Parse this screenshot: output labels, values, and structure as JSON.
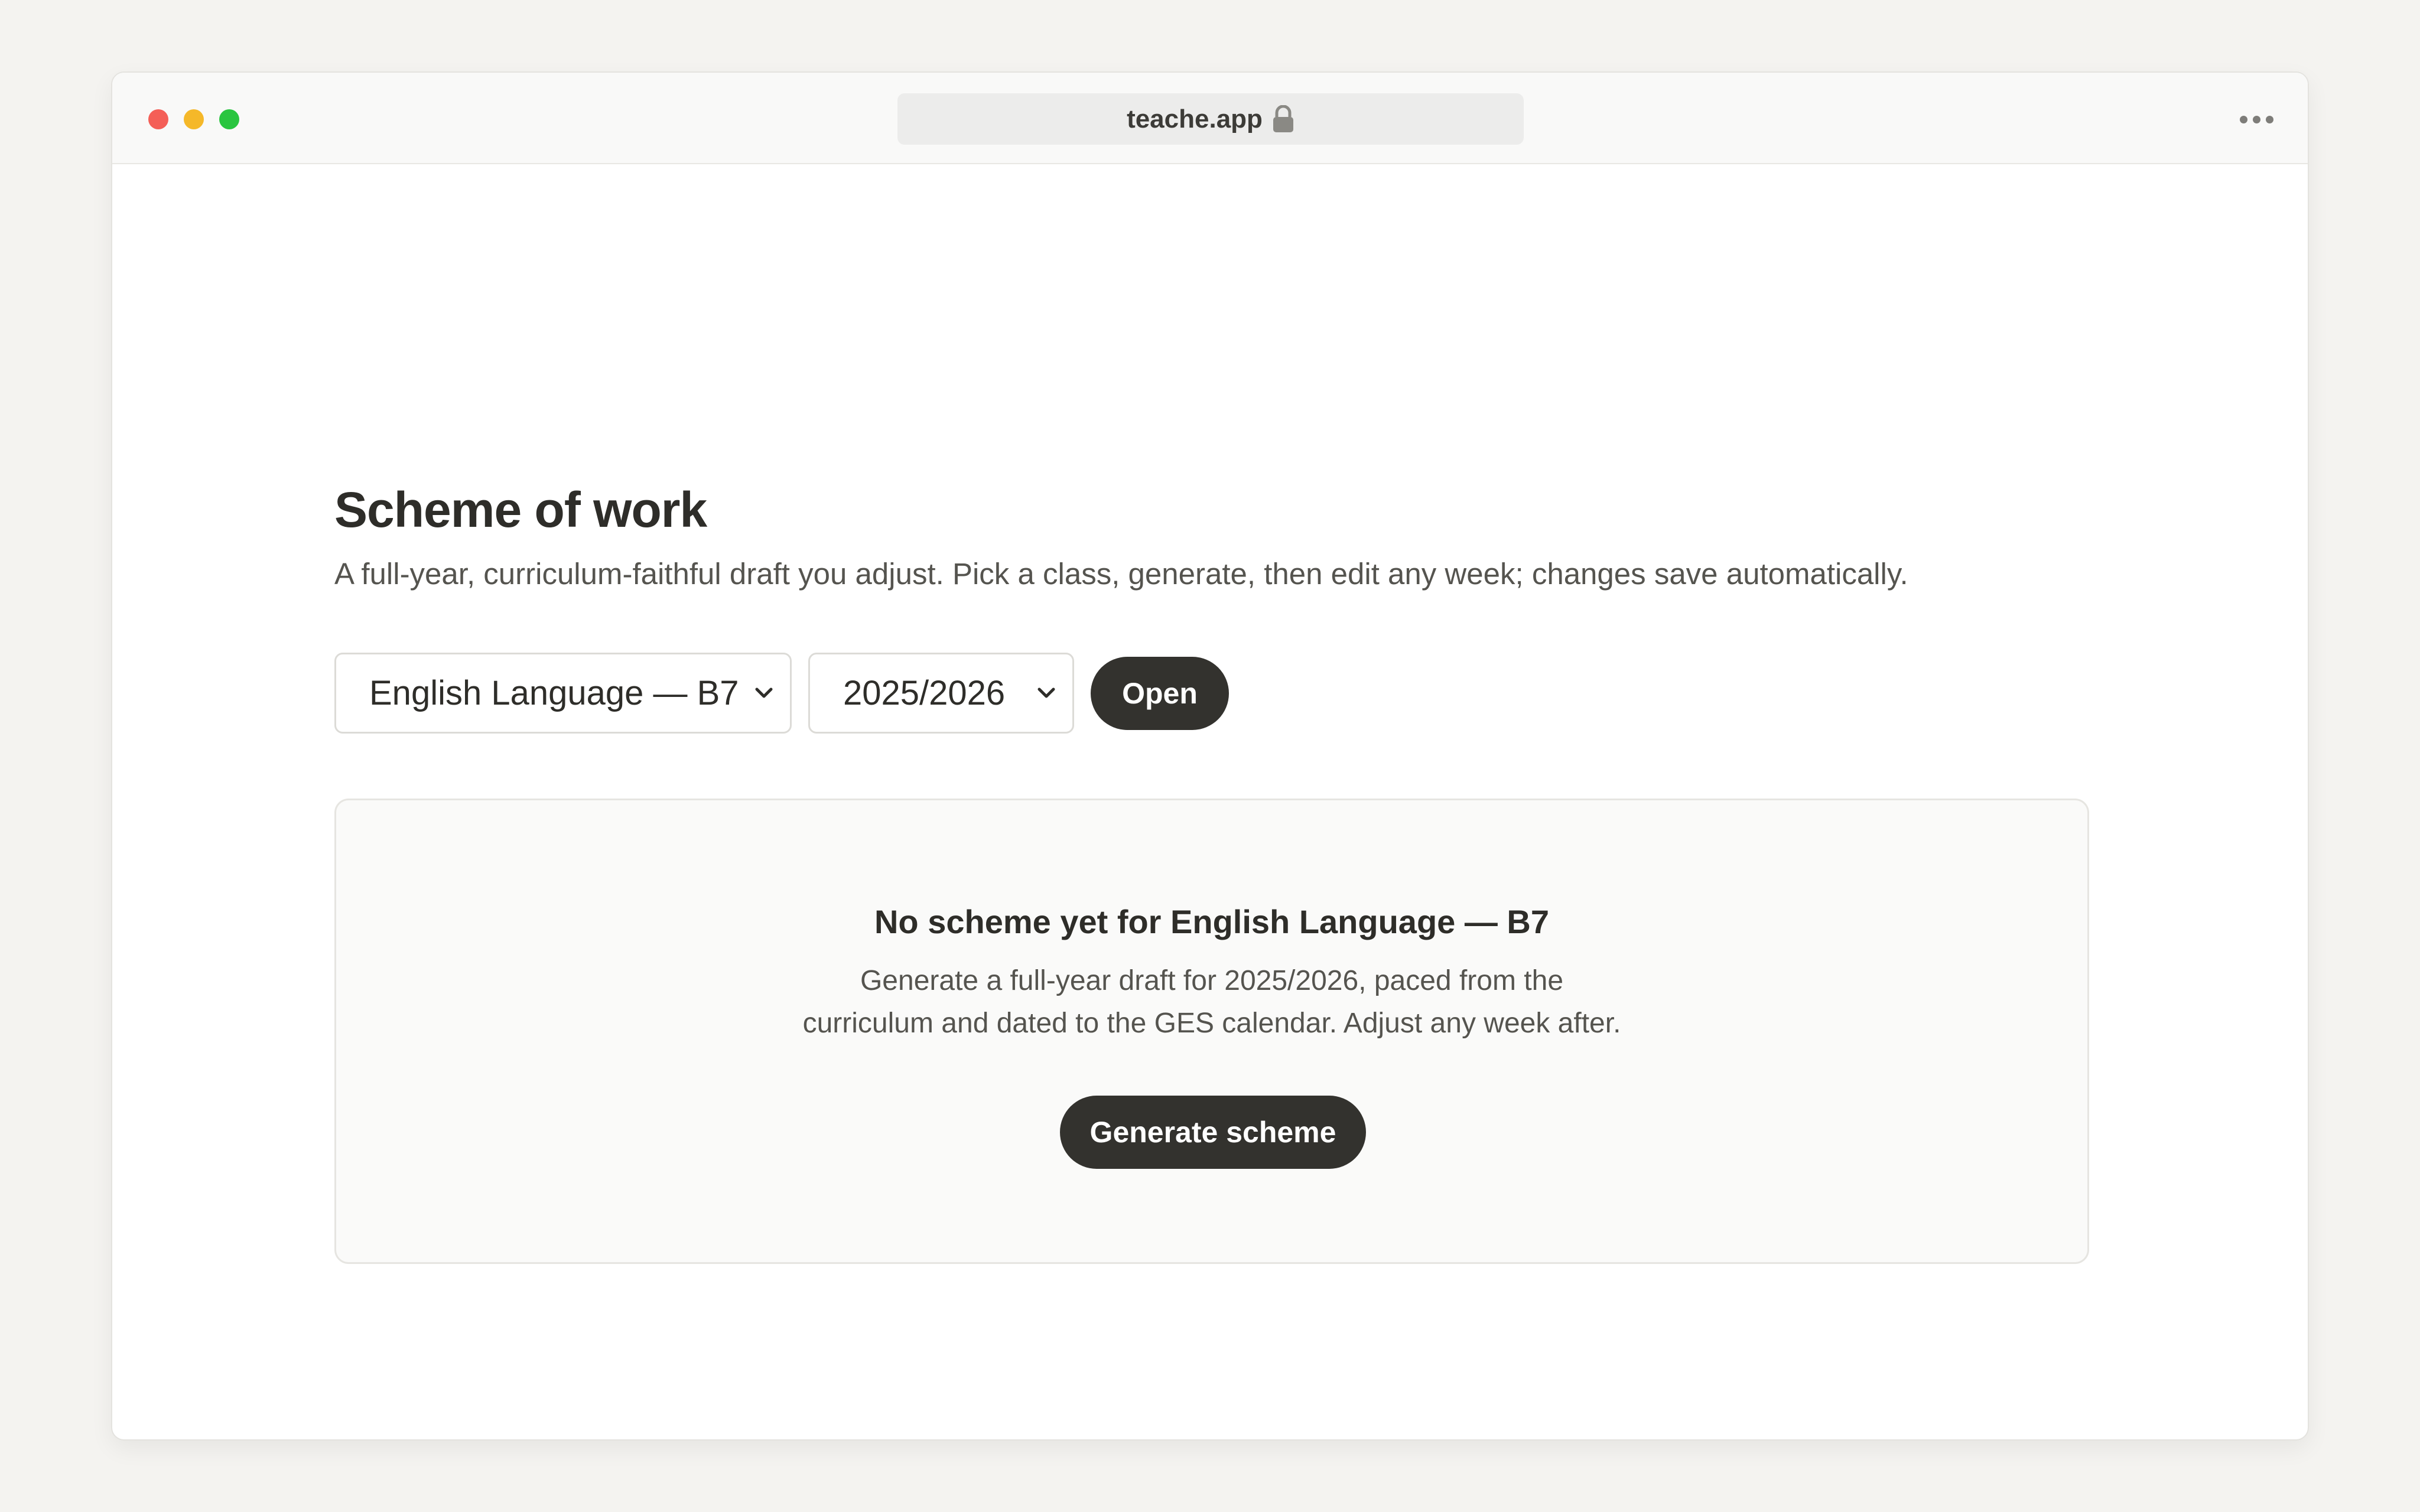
{
  "browser": {
    "url": "teache.app",
    "lock_icon": "lock-icon",
    "more_icon": "more-horizontal-icon"
  },
  "page": {
    "title": "Scheme of work",
    "subtitle": "A full-year, curriculum-faithful draft you adjust. Pick a class, generate, then edit any week; changes save automatically."
  },
  "controls": {
    "class_select": {
      "value": "English Language — B7",
      "icon": "chevron-down-icon"
    },
    "year_select": {
      "value": "2025/2026",
      "icon": "chevron-down-icon"
    },
    "open_label": "Open"
  },
  "empty_state": {
    "title": "No scheme yet for English Language — B7",
    "description_line1": "Generate a full-year draft for 2025/2026, paced from the",
    "description_line2": "curriculum and dated to the GES calendar. Adjust any week after.",
    "button_label": "Generate scheme"
  },
  "colors": {
    "primary_button": "#33322e",
    "background": "#f4f3f0",
    "traffic_red": "#f45f57",
    "traffic_yellow": "#f5b829",
    "traffic_green": "#29c53f"
  }
}
